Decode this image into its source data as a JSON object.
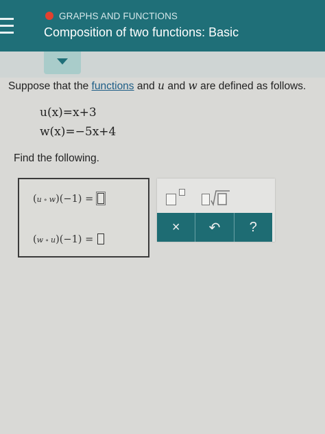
{
  "header": {
    "topic": "GRAPHS AND FUNCTIONS",
    "title": "Composition of two functions: Basic",
    "topic_dot_color": "#e2412f",
    "bar_color": "#1f6f78"
  },
  "icons": {
    "menu": "hamburger-menu-icon",
    "collapse": "chevron-down-icon",
    "clear": "multiply-x-icon",
    "undo": "undo-arrow-icon",
    "help": "question-mark-icon"
  },
  "question": {
    "intro_before": "Suppose that the ",
    "link_text": "functions",
    "var_u": "u",
    "mid": " and ",
    "var_w": "w",
    "intro_after": " are defined as follows.",
    "eq_u": "u(x)=x+3",
    "eq_w": "w(x)=−5x+4",
    "find_label": "Find the following."
  },
  "answers": [
    {
      "f": "u",
      "g": "w",
      "arg": "(−1) =",
      "value": ""
    },
    {
      "f": "w",
      "g": "u",
      "arg": "(−1) =",
      "value": ""
    }
  ],
  "palette": {
    "superscript": "box-with-exponent",
    "sqrt": "box-with-square-root"
  },
  "toolbar": {
    "clear_label": "×",
    "undo_label": "↶",
    "help_label": "?"
  }
}
